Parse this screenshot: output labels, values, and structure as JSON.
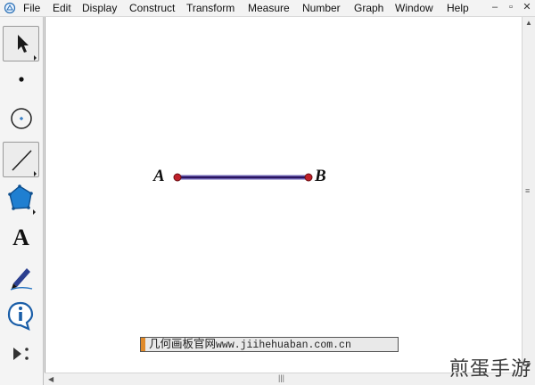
{
  "menu": [
    "File",
    "Edit",
    "Display",
    "Construct",
    "Transform",
    "Measure",
    "Number",
    "Graph",
    "Window",
    "Help"
  ],
  "window_controls": {
    "minimize": "–",
    "restore": "▫",
    "close": "✕"
  },
  "tools": [
    "arrow-selection-tool",
    "point-tool",
    "compass-tool",
    "straightedge-tool",
    "polygon-tool",
    "text-tool",
    "marker-tool",
    "information-tool",
    "custom-tools"
  ],
  "text_tool_glyph": "A",
  "segment": {
    "start_label": "A",
    "end_label": "B",
    "color": "#3a1f7a",
    "point_color": "#c0202a"
  },
  "caption": {
    "chinese": "几何画板官网",
    "url": "www.jiihehuaban.com.cn"
  },
  "watermark": "煎蛋手游"
}
